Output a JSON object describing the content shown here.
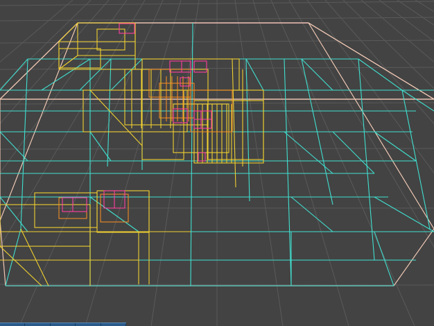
{
  "viewport": {
    "background_color": "#434343",
    "grid_color": "#5a5a5a"
  },
  "colors": {
    "level_root": "#f0c8b4",
    "level_1": "#e8b8b0",
    "level_2": "#40e0d0",
    "level_3": "#f0d030",
    "level_4": "#ff9020",
    "level_5": "#ff40a0"
  },
  "toolbar": {
    "segments": 5
  }
}
